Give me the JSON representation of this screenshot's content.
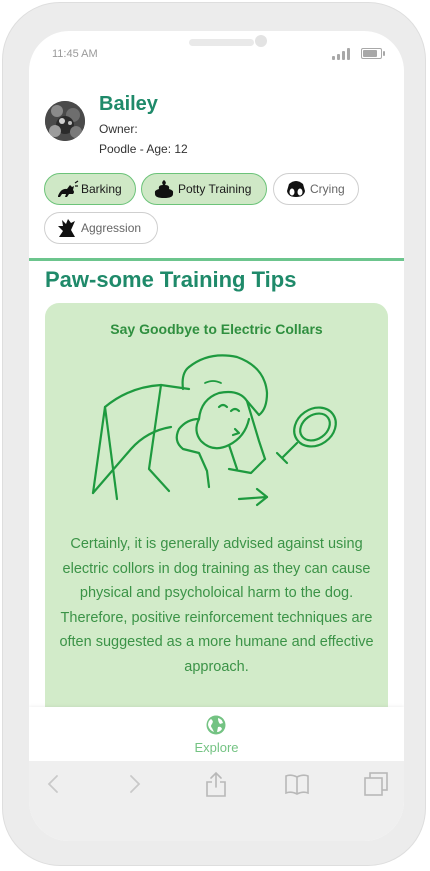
{
  "status_bar": {
    "time": "11:45 AM"
  },
  "profile": {
    "name": "Bailey",
    "owner": "Owner:",
    "breed_age": "Poodle - Age: 12"
  },
  "chips": [
    {
      "label": "Barking",
      "icon": "barking-dog-icon",
      "active": true
    },
    {
      "label": "Potty Training",
      "icon": "poop-icon",
      "active": true
    },
    {
      "label": "Crying",
      "icon": "crying-dog-icon",
      "active": false
    },
    {
      "label": "Aggression",
      "icon": "aggression-icon",
      "active": false
    }
  ],
  "section": {
    "title": "Paw-some Training Tips"
  },
  "card": {
    "title": "Say Goodbye to Electric Collars",
    "illustration": "person-with-magnifying-glass",
    "body": "Certainly, it is generally advised against using electric collors in dog training as they can cause physical and psycholoical harm to the dog. Therefore, positive reinforcement techniques are often suggested as a more humane and effective approach."
  },
  "bottom_nav": {
    "explore_label": "Explore",
    "icon": "globe-icon"
  },
  "toolbar": {
    "icons": [
      "back-arrow-icon",
      "forward-arrow-icon",
      "share-icon",
      "bookmarks-icon",
      "tabs-icon"
    ]
  },
  "colors": {
    "brand_green": "#1f8a6a",
    "chip_active_bg": "#cfe8c6",
    "card_bg": "#d2ebc9",
    "card_text": "#3b9347",
    "divider": "#6cc58d"
  }
}
